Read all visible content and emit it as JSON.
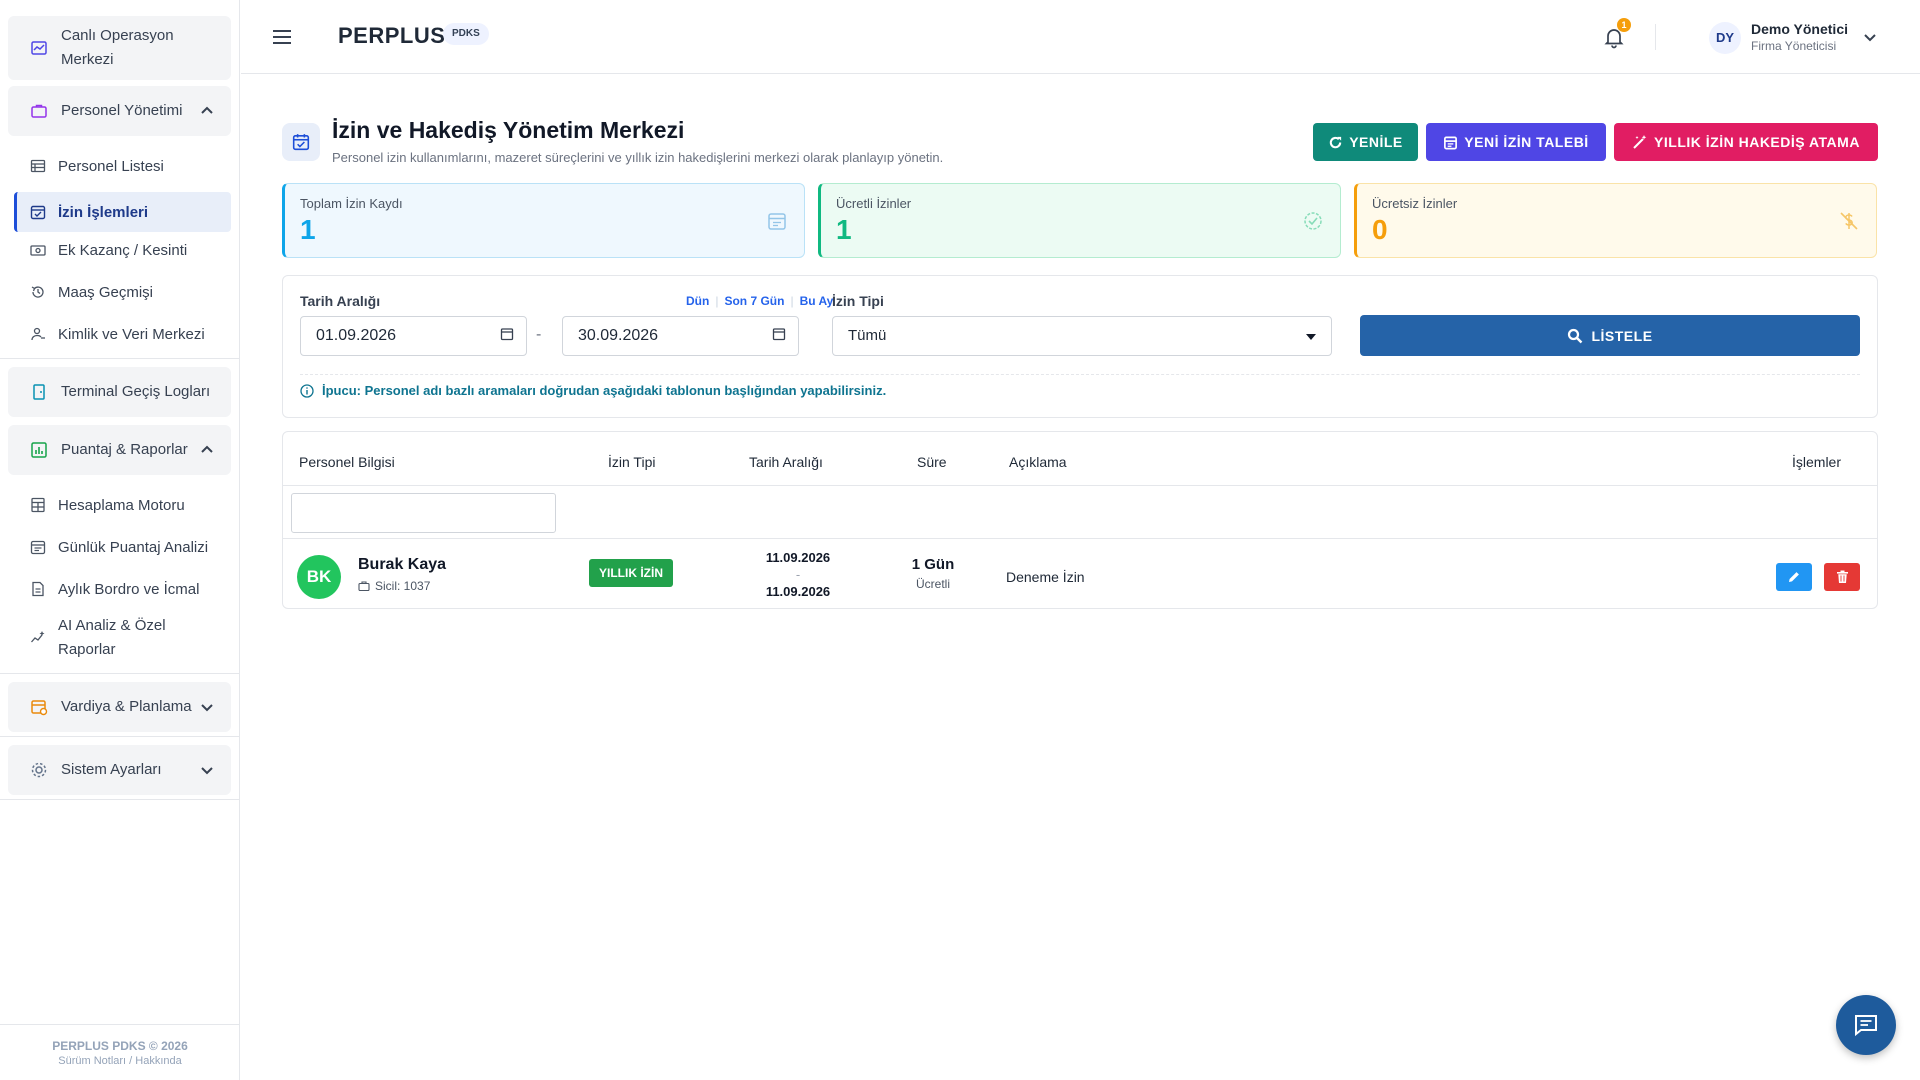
{
  "sidebar": {
    "top_item": {
      "label": "Canlı Operasyon Merkezi"
    },
    "groups": [
      {
        "label": "Personel Yönetimi"
      },
      {
        "label": "Terminal Geçiş Logları"
      },
      {
        "label": "Puantaj & Raporlar"
      },
      {
        "label": "Vardiya & Planlama"
      },
      {
        "label": "Sistem Ayarları"
      }
    ],
    "personel_items": [
      {
        "label": "Personel Listesi"
      },
      {
        "label": "İzin İşlemleri"
      },
      {
        "label": "Ek Kazanç / Kesinti"
      },
      {
        "label": "Maaş Geçmişi"
      },
      {
        "label": "Kimlik ve Veri Merkezi"
      }
    ],
    "puantaj_items": [
      {
        "label": "Hesaplama Motoru"
      },
      {
        "label": "Günlük Puantaj Analizi"
      },
      {
        "label": "Aylık Bordro ve İcmal"
      },
      {
        "label": "AI Analiz & Özel Raporlar"
      }
    ],
    "footer": {
      "copyright": "PERPLUS PDKS © 2026",
      "links": "Sürüm Notları / Hakkında"
    }
  },
  "header": {
    "brand": "PERPLUS",
    "brand_badge": "PDKS",
    "notification_count": "1",
    "user_initials": "DY",
    "user_name": "Demo Yönetici",
    "user_role": "Firma Yöneticisi"
  },
  "page": {
    "title": "İzin ve Hakediş Yönetim Merkezi",
    "subtitle": "Personel izin kullanımlarını, mazeret süreçlerini ve yıllık izin hakedişlerini merkezi olarak planlayıp yönetin.",
    "buttons": {
      "refresh": "YENİLE",
      "new_request": "YENİ İZİN TALEBİ",
      "annual_assign": "YILLIK İZİN HAKEDİŞ ATAMA"
    }
  },
  "stats": [
    {
      "label": "Toplam İzin Kaydı",
      "value": "1",
      "color": "#0ea5e9"
    },
    {
      "label": "Ücretli İzinler",
      "value": "1",
      "color": "#10b981"
    },
    {
      "label": "Ücretsiz İzinler",
      "value": "0",
      "color": "#f59e0b"
    }
  ],
  "filters": {
    "date_range_label": "Tarih Aralığı",
    "quick_links": [
      "Dün",
      "Son 7 Gün",
      "Bu Ay"
    ],
    "start_date": "01.09.2026",
    "separator": "-",
    "end_date": "30.09.2026",
    "leave_type_label": "İzin Tipi",
    "leave_type_value": "Tümü",
    "list_button": "LİSTELE",
    "tip": "İpucu: Personel adı bazlı aramaları doğrudan aşağıdaki tablonun başlığından yapabilirsiniz."
  },
  "table": {
    "columns": [
      "Personel Bilgisi",
      "İzin Tipi",
      "Tarih Aralığı",
      "Süre",
      "Açıklama",
      "İşlemler"
    ],
    "rows": [
      {
        "initials": "BK",
        "name": "Burak Kaya",
        "sicil": "Sicil: 1037",
        "leave_type": "YILLIK İZİN",
        "start": "11.09.2026",
        "date_sep": "-",
        "end": "11.09.2026",
        "duration": "1 Gün",
        "pay": "Ücretli",
        "description": "Deneme İzin"
      }
    ]
  },
  "colors": {
    "primary": "#2563a8",
    "refresh": "#0f8a7a",
    "new_request": "#4f46e5",
    "annual": "#e11d63",
    "edit": "#2196f3",
    "delete": "#e53935",
    "badge_green": "#22a14b"
  },
  "icons": [
    "chart-window-icon",
    "briefcase-icon",
    "chevron-up-icon",
    "list-icon",
    "calendar-check-icon",
    "money-icon",
    "history-icon",
    "user-id-icon",
    "door-icon",
    "chart-bar-icon",
    "calculator-icon",
    "calendar-icon",
    "document-icon",
    "sparkle-icon",
    "calendar-clock-icon",
    "gear-icon",
    "chevron-down-icon",
    "menu-icon",
    "bell-icon",
    "refresh-icon",
    "magic-wand-icon",
    "search-icon",
    "info-icon",
    "pencil-icon",
    "trash-icon",
    "chat-icon"
  ]
}
